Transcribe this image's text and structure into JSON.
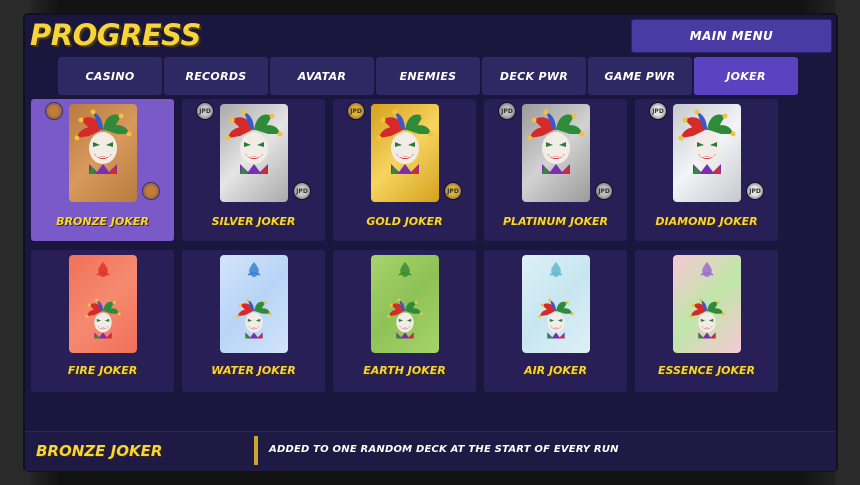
{
  "header": {
    "title": "PROGRESS",
    "main_menu_label": "MAIN MENU"
  },
  "tabs": [
    {
      "label": "CASINO",
      "active": false
    },
    {
      "label": "RECORDS",
      "active": false
    },
    {
      "label": "AVATAR",
      "active": false
    },
    {
      "label": "ENEMIES",
      "active": false
    },
    {
      "label": "DECK PWR",
      "active": false
    },
    {
      "label": "GAME PWR",
      "active": false
    },
    {
      "label": "JOKER",
      "active": true
    }
  ],
  "jokers": [
    {
      "label": "BRONZE JOKER",
      "selected": true,
      "bg": "#b87a3e",
      "bg2": "#d89a5c",
      "medal": "#c37a3a",
      "medal_text": ""
    },
    {
      "label": "SILVER JOKER",
      "selected": false,
      "bg": "#a9a9a9",
      "bg2": "#e5e5e5",
      "medal": "#c8c8c8",
      "medal_text": "JPD"
    },
    {
      "label": "GOLD JOKER",
      "selected": false,
      "bg": "#d4a11c",
      "bg2": "#f6d460",
      "medal": "#e0b030",
      "medal_text": "JPD"
    },
    {
      "label": "PLATINUM JOKER",
      "selected": false,
      "bg": "#9a9a9a",
      "bg2": "#d2d2d2",
      "medal": "#bdbdbd",
      "medal_text": "JPD"
    },
    {
      "label": "DIAMOND JOKER",
      "selected": false,
      "bg": "#c6c8cc",
      "bg2": "#f2f4f7",
      "medal": "#e4e4e4",
      "medal_text": "JPD"
    },
    {
      "label": "FIRE JOKER",
      "selected": false,
      "bg": "#f27058",
      "bg2": "#f48a70",
      "icon": "fire-icon",
      "icon_color": "#e0322a"
    },
    {
      "label": "WATER JOKER",
      "selected": false,
      "bg": "#d2e4fb",
      "bg2": "#b8d4f6",
      "icon": "water-icon",
      "icon_color": "#3a7fd1"
    },
    {
      "label": "EARTH JOKER",
      "selected": false,
      "bg": "#a6d46b",
      "bg2": "#8ec257",
      "icon": "earth-icon",
      "icon_color": "#3f8a2f"
    },
    {
      "label": "AIR JOKER",
      "selected": false,
      "bg": "#dff0f6",
      "bg2": "#c7e6f0",
      "icon": "air-icon",
      "icon_color": "#63b7cf"
    },
    {
      "label": "ESSENCE JOKER",
      "selected": false,
      "bg": "#f7c8d6",
      "bg2": "#bfe6a8",
      "icon": "essence-icon",
      "icon_color": "#9c6ad2"
    }
  ],
  "selection": {
    "name": "BRONZE JOKER",
    "description": "ADDED TO ONE RANDOM DECK AT THE START OF EVERY RUN"
  },
  "colors": {
    "accent_yellow": "#f7d43a",
    "panel": "#1b163d",
    "card": "#271f55",
    "selected_card": "#7a5ac8",
    "active_tab": "#5a43c0",
    "tab": "#2e2963"
  }
}
